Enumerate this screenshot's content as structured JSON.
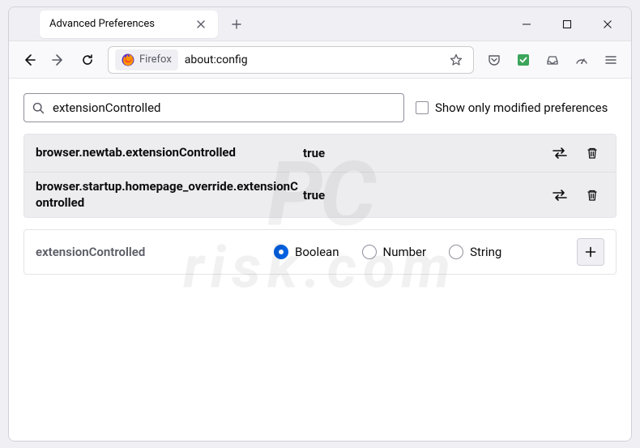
{
  "window": {
    "tab_title": "Advanced Preferences"
  },
  "urlbar": {
    "identity": "Firefox",
    "address": "about:config"
  },
  "search": {
    "value": "extensionControlled",
    "checkbox_label": "Show only modified preferences"
  },
  "prefs": [
    {
      "name": "browser.newtab.extensionControlled",
      "value": "true"
    },
    {
      "name": "browser.startup.homepage_override.extensionControlled",
      "value": "true"
    }
  ],
  "add_pref": {
    "name": "extensionControlled",
    "types": [
      {
        "label": "Boolean",
        "checked": true
      },
      {
        "label": "Number",
        "checked": false
      },
      {
        "label": "String",
        "checked": false
      }
    ]
  },
  "watermark": {
    "line1": "PC",
    "line2": "risk.com"
  }
}
